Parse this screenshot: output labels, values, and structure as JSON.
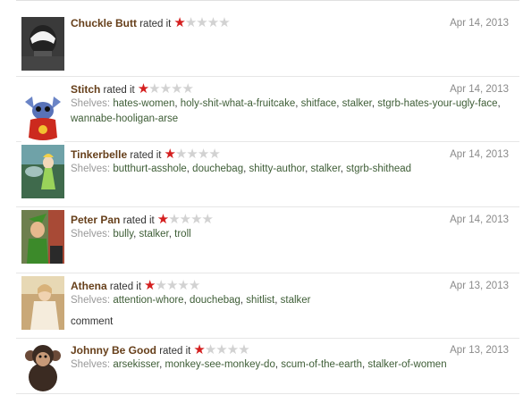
{
  "rated_text": "rated it",
  "shelves_label": "Shelves:",
  "reviews": [
    {
      "user": "Chuckle Butt",
      "rating": 1,
      "date": "Apr 14, 2013",
      "shelves": [],
      "avatar": "hooded-figure-avatar"
    },
    {
      "user": "Stitch",
      "rating": 1,
      "date": "Apr 14, 2013",
      "shelves": [
        "hates-women",
        "holy-shit-what-a-fruitcake",
        "shitface",
        "stalker",
        "stgrb-hates-your-ugly-face",
        "wannabe-hooligan-arse"
      ],
      "avatar": "stitch-avatar"
    },
    {
      "user": "Tinkerbelle",
      "rating": 1,
      "date": "Apr 14, 2013",
      "shelves": [
        "butthurt-asshole",
        "douchebag",
        "shitty-author",
        "stalker",
        "stgrb-shithead"
      ],
      "avatar": "tinkerbell-avatar"
    },
    {
      "user": "Peter Pan",
      "rating": 1,
      "date": "Apr 14, 2013",
      "shelves": [
        "bully",
        "stalker",
        "troll"
      ],
      "avatar": "peter-pan-avatar"
    },
    {
      "user": "Athena",
      "rating": 1,
      "date": "Apr 13, 2013",
      "shelves": [
        "attention-whore",
        "douchebag",
        "shitlist",
        "stalker"
      ],
      "comment": "comment",
      "avatar": "athena-avatar"
    },
    {
      "user": "Johnny Be Good",
      "rating": 1,
      "date": "Apr 13, 2013",
      "shelves": [
        "arsekisser",
        "monkey-see-monkey-do",
        "scum-of-the-earth",
        "stalker-of-women"
      ],
      "avatar": "monkey-avatar"
    }
  ],
  "colors": {
    "username": "#663f1a",
    "star_filled": "#d41f1f",
    "star_empty": "#d2d2d2",
    "shelf_link": "#3e5d36",
    "date": "#8a8a8a"
  }
}
